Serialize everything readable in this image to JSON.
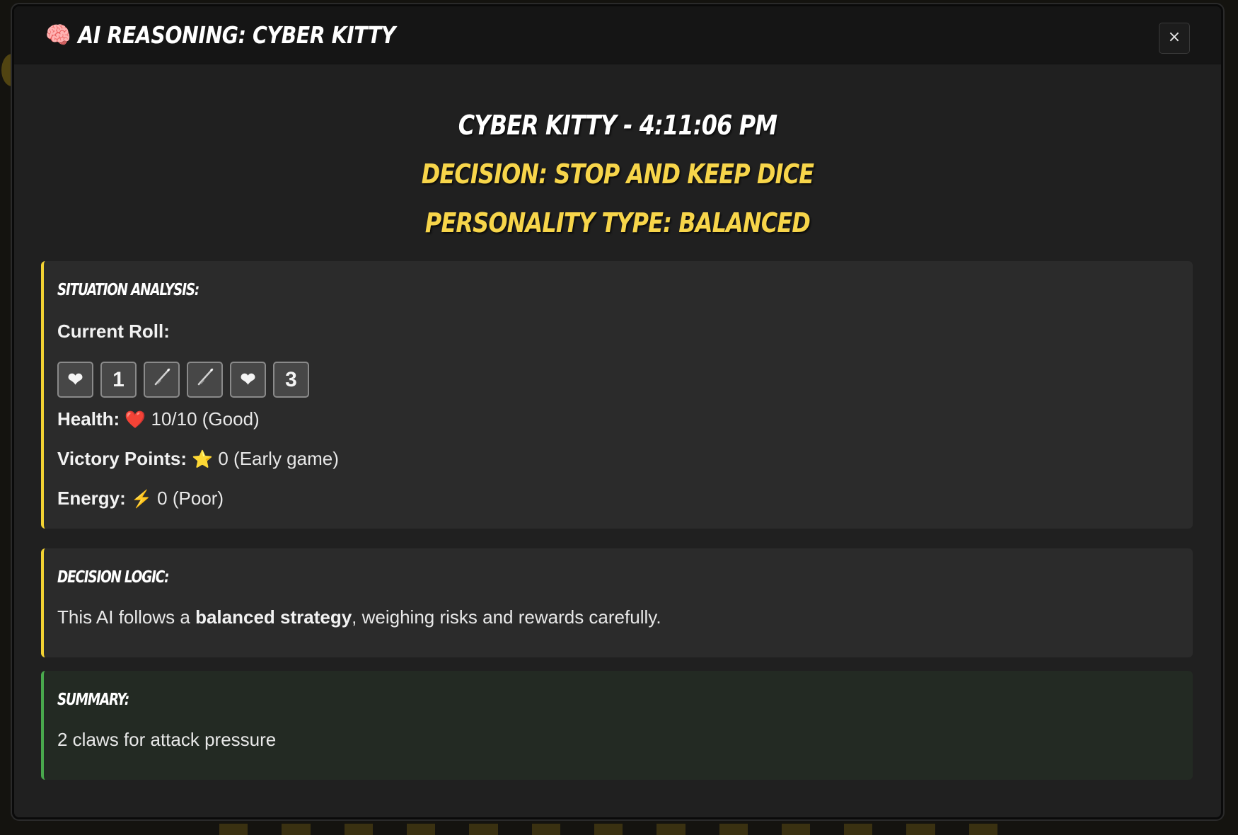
{
  "modal": {
    "title": "AI REASONING: CYBER KITTY",
    "title_icon": "brain-icon",
    "close_label": "×"
  },
  "heading": {
    "player_time": "CYBER KITTY - 4:11:06 PM",
    "decision": "DECISION: STOP AND KEEP DICE",
    "personality": "PERSONALITY TYPE: BALANCED"
  },
  "situation": {
    "title": "SITUATION ANALYSIS:",
    "current_roll_label": "Current Roll:",
    "dice": [
      {
        "face": "heart",
        "glyph": "❤",
        "icon": "heart-icon"
      },
      {
        "face": "1",
        "glyph": "1"
      },
      {
        "face": "attack",
        "glyph": "",
        "icon": "claw-icon"
      },
      {
        "face": "attack",
        "glyph": "",
        "icon": "claw-icon"
      },
      {
        "face": "heart",
        "glyph": "❤",
        "icon": "heart-icon"
      },
      {
        "face": "3",
        "glyph": "3"
      }
    ],
    "health_label": "Health:",
    "health_emoji": "❤️",
    "health_value": "10/10 (Good)",
    "vp_label": "Victory Points:",
    "vp_emoji": "⭐",
    "vp_value": "0 (Early game)",
    "energy_label": "Energy:",
    "energy_emoji": "⚡",
    "energy_value": "0 (Poor)"
  },
  "logic": {
    "title": "DECISION LOGIC:",
    "text_before": "This AI follows a ",
    "text_bold": "balanced strategy",
    "text_after": ", weighing risks and rewards carefully."
  },
  "summary": {
    "title": "SUMMARY:",
    "text": "2 claws for attack pressure"
  },
  "colors": {
    "accent_gold": "#f7d54a",
    "summary_green": "#49a84d",
    "modal_bg": "#202020"
  }
}
